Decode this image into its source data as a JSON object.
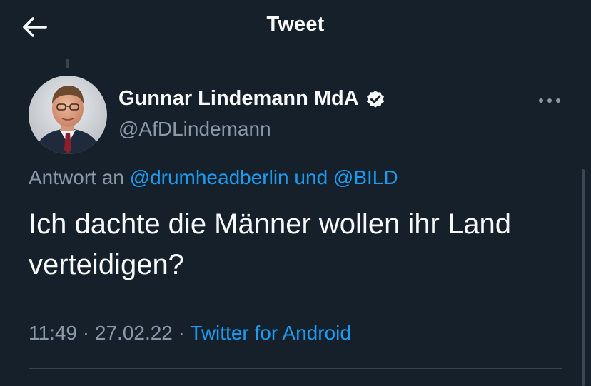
{
  "header": {
    "title": "Tweet",
    "back_icon": "arrow-left-icon"
  },
  "author": {
    "name": "Gunnar Lindemann MdA",
    "handle": "@AfDLindemann",
    "verified": true,
    "verified_icon": "verified-badge-icon"
  },
  "more_icon": "more-horizontal-icon",
  "reply_context": {
    "prefix": "Antwort an",
    "mention_1": "@drumheadberlin",
    "joiner": "und",
    "mention_2": "@BILD"
  },
  "tweet": {
    "text_line_1": "Ich dachte die Männer wollen ihr Land",
    "text_line_2": "verteidigen?"
  },
  "meta": {
    "time": "11:49",
    "sep_1": "·",
    "date": "27.02.22",
    "sep_2": "·",
    "source": "Twitter for Android"
  },
  "colors": {
    "background": "#15202b",
    "link": "#1d9bf0",
    "secondary_text": "#8b98a5",
    "primary_text": "#f7f9f9",
    "divider": "#38444d"
  }
}
